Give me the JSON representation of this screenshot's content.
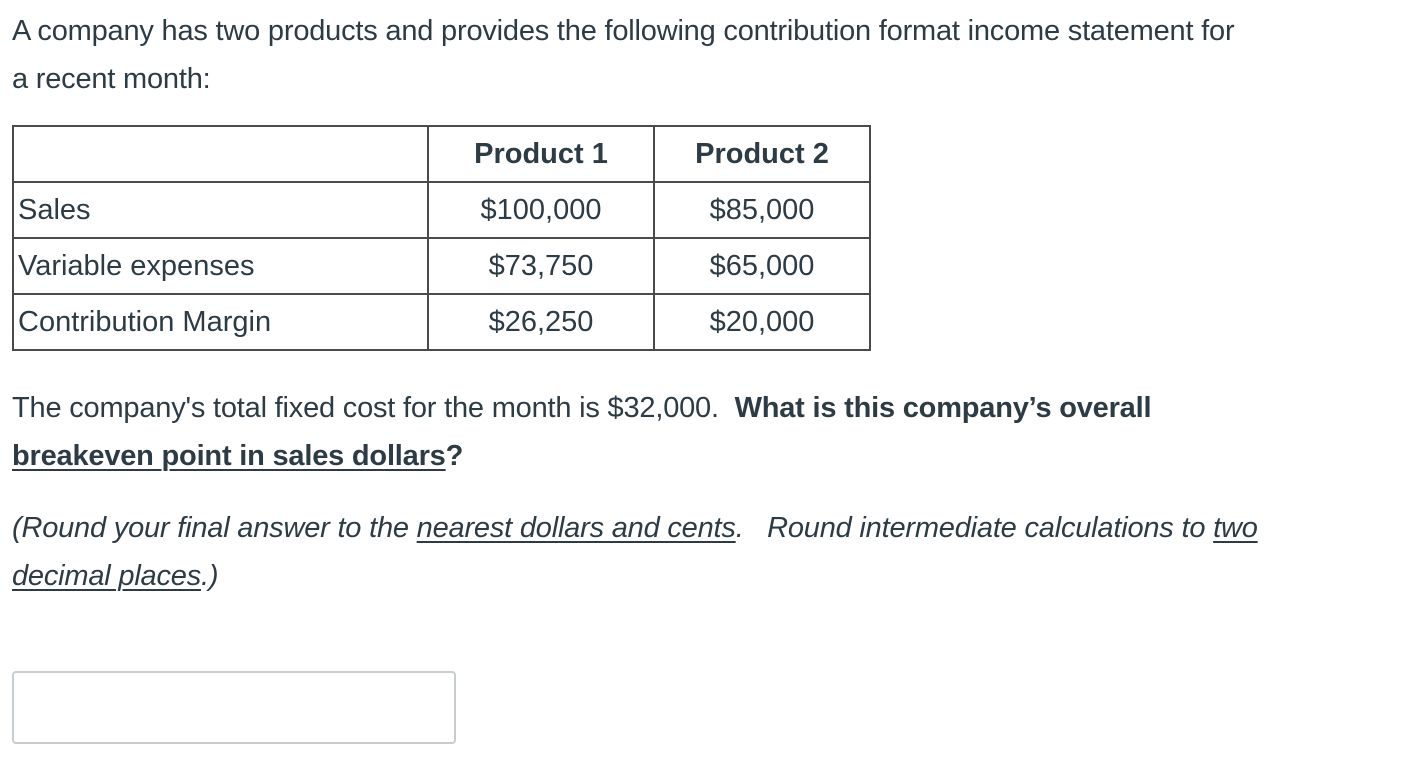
{
  "intro": {
    "line1": "A company has two products and provides the following contribution format income statement for",
    "line2": "a recent month:"
  },
  "table": {
    "headers": [
      "",
      "Product 1",
      "Product 2"
    ],
    "rows": [
      {
        "label": "Sales",
        "product1": "$100,000",
        "product2": "$85,000"
      },
      {
        "label": "Variable expenses",
        "product1": "$73,750",
        "product2": "$65,000"
      },
      {
        "label": "Contribution Margin",
        "product1": "$26,250",
        "product2": "$20,000"
      }
    ]
  },
  "question": {
    "plain": "The company's total fixed cost for the month is $32,000.  ",
    "bold_line1": "What is this company’s overall",
    "bold_underlined": "breakeven point in sales dollars",
    "bold_end": "?"
  },
  "instructions": {
    "part1": "(Round your final answer to the ",
    "underline1": "nearest dollars and cents",
    "part2": ".   Round intermediate calculations to ",
    "underline2a": "two",
    "underline2b": "decimal places",
    "part3": ".)"
  },
  "answer": {
    "value": "",
    "placeholder": ""
  }
}
